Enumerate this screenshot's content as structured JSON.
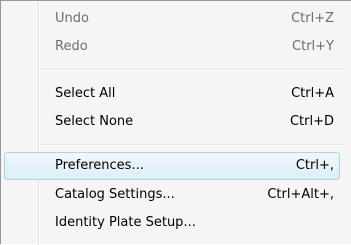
{
  "menu": {
    "items": [
      {
        "label": "Undo",
        "shortcut": "Ctrl+Z"
      },
      {
        "label": "Redo",
        "shortcut": "Ctrl+Y"
      },
      {
        "label": "Select All",
        "shortcut": "Ctrl+A"
      },
      {
        "label": "Select None",
        "shortcut": "Ctrl+D"
      },
      {
        "label": "Preferences...",
        "shortcut": "Ctrl+,"
      },
      {
        "label": "Catalog Settings...",
        "shortcut": "Ctrl+Alt+,"
      },
      {
        "label": "Identity Plate Setup...",
        "shortcut": ""
      }
    ]
  }
}
